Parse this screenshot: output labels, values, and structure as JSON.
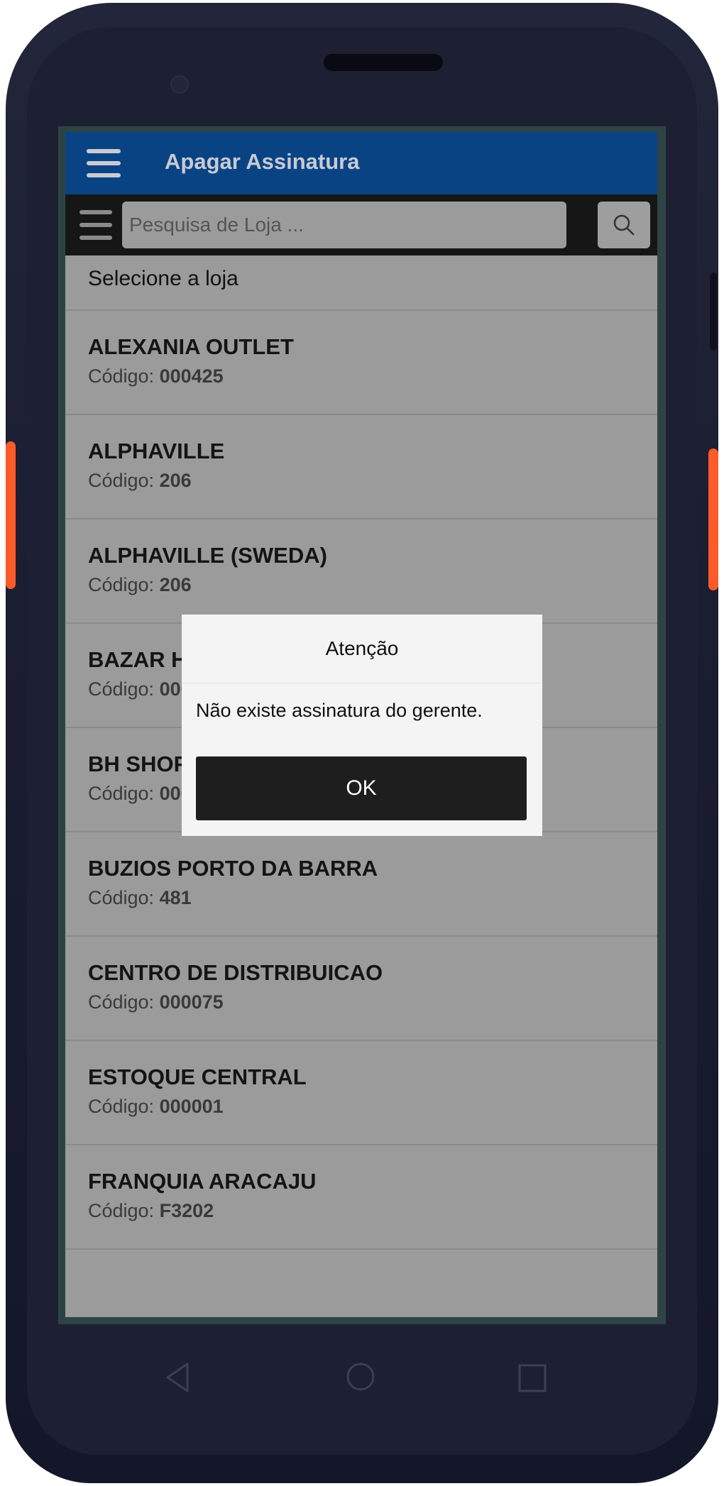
{
  "app": {
    "title": "Apagar Assinatura"
  },
  "search": {
    "placeholder": "Pesquisa de Loja ..."
  },
  "section_label": "Selecione a loja",
  "stores": [
    {
      "name": "ALEXANIA OUTLET",
      "code_label": "Código:",
      "code": "000425"
    },
    {
      "name": "ALPHAVILLE",
      "code_label": "Código:",
      "code": "206"
    },
    {
      "name": "ALPHAVILLE (SWEDA)",
      "code_label": "Código:",
      "code": "206"
    },
    {
      "name": "BAZAR HORTO III",
      "code_label": "Código:",
      "code": "000509"
    },
    {
      "name": "BH SHOP",
      "code_label": "Código:",
      "code": "000"
    },
    {
      "name": "BUZIOS PORTO DA BARRA",
      "code_label": "Código:",
      "code": "481"
    },
    {
      "name": "CENTRO DE DISTRIBUICAO",
      "code_label": "Código:",
      "code": "000075"
    },
    {
      "name": "ESTOQUE CENTRAL",
      "code_label": "Código:",
      "code": "000001"
    },
    {
      "name": "FRANQUIA ARACAJU",
      "code_label": "Código:",
      "code": "F3202"
    }
  ],
  "dialog": {
    "title": "Atenção",
    "message": "Não existe assinatura do gerente.",
    "ok_label": "OK"
  },
  "icons": {
    "menu": "hamburger-icon",
    "search": "search-icon",
    "back": "back-triangle-icon",
    "home": "home-circle-icon",
    "recent": "recent-square-icon"
  },
  "colors": {
    "topbar": "#0a4384",
    "searchbar": "#161616",
    "overlay_list": "#9b9b9b",
    "dialog_button": "#1e1e1e"
  }
}
